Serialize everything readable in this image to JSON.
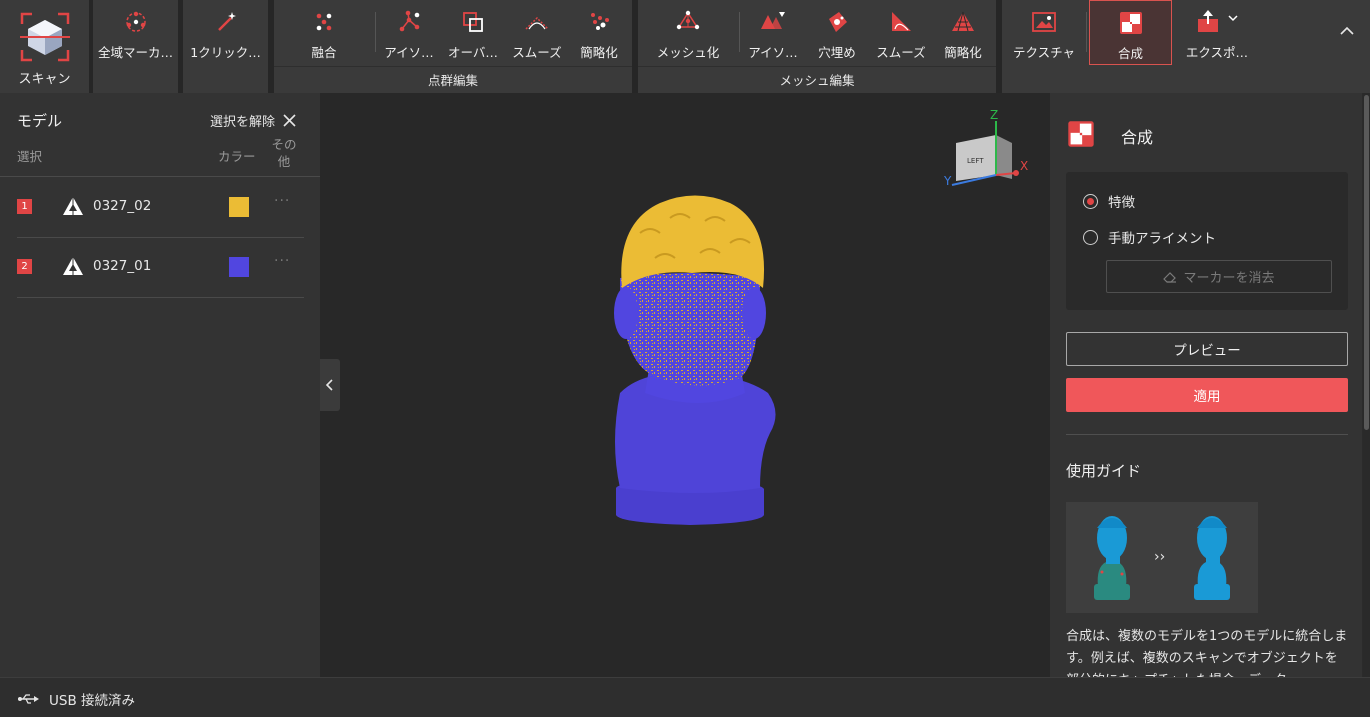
{
  "toolbar": {
    "scan_label": "スキャン",
    "global_marker_label": "全域マーカ…",
    "one_click_label": "1クリック…",
    "pointcloud": {
      "group_label": "点群編集",
      "merge": "融合",
      "isolate": "アイソ…",
      "overlap": "オーバ…",
      "smooth": "スムーズ",
      "simplify": "簡略化"
    },
    "mesh": {
      "group_label": "メッシュ編集",
      "meshify": "メッシュ化",
      "isolate": "アイソ…",
      "fill_holes": "穴埋め",
      "smooth": "スムーズ",
      "simplify": "簡略化"
    },
    "texture_label": "テクスチャ",
    "composite_label": "合成",
    "export_label": "エクスポ…"
  },
  "left_panel": {
    "title": "モデル",
    "deselect": "選択を解除",
    "col_select": "選択",
    "col_color": "カラー",
    "col_other": "その他",
    "models": [
      {
        "index": "1",
        "name": "0327_02",
        "color": "#ebbc35"
      },
      {
        "index": "2",
        "name": "0327_01",
        "color": "#5146e0"
      }
    ]
  },
  "viewport": {
    "axis_z": "Z",
    "axis_x": "X",
    "axis_y": "Y",
    "cube_face": "LEFT"
  },
  "right_panel": {
    "title": "合成",
    "option_feature": "特徴",
    "option_manual": "手動アライメント",
    "clear_markers": "マーカーを消去",
    "preview": "プレビュー",
    "apply": "適用",
    "guide_title": "使用ガイド",
    "guide_text": "合成は、複数のモデルを1つのモデルに統合します。例えば、複数のスキャンでオブジェクトを部分的にキャプチャした場合、データ"
  },
  "status": {
    "usb": "USB 接続済み"
  },
  "colors": {
    "accent": "#e04545",
    "apply": "#f0575a",
    "model_gold": "#ebbc35",
    "model_blue": "#5146e0"
  }
}
